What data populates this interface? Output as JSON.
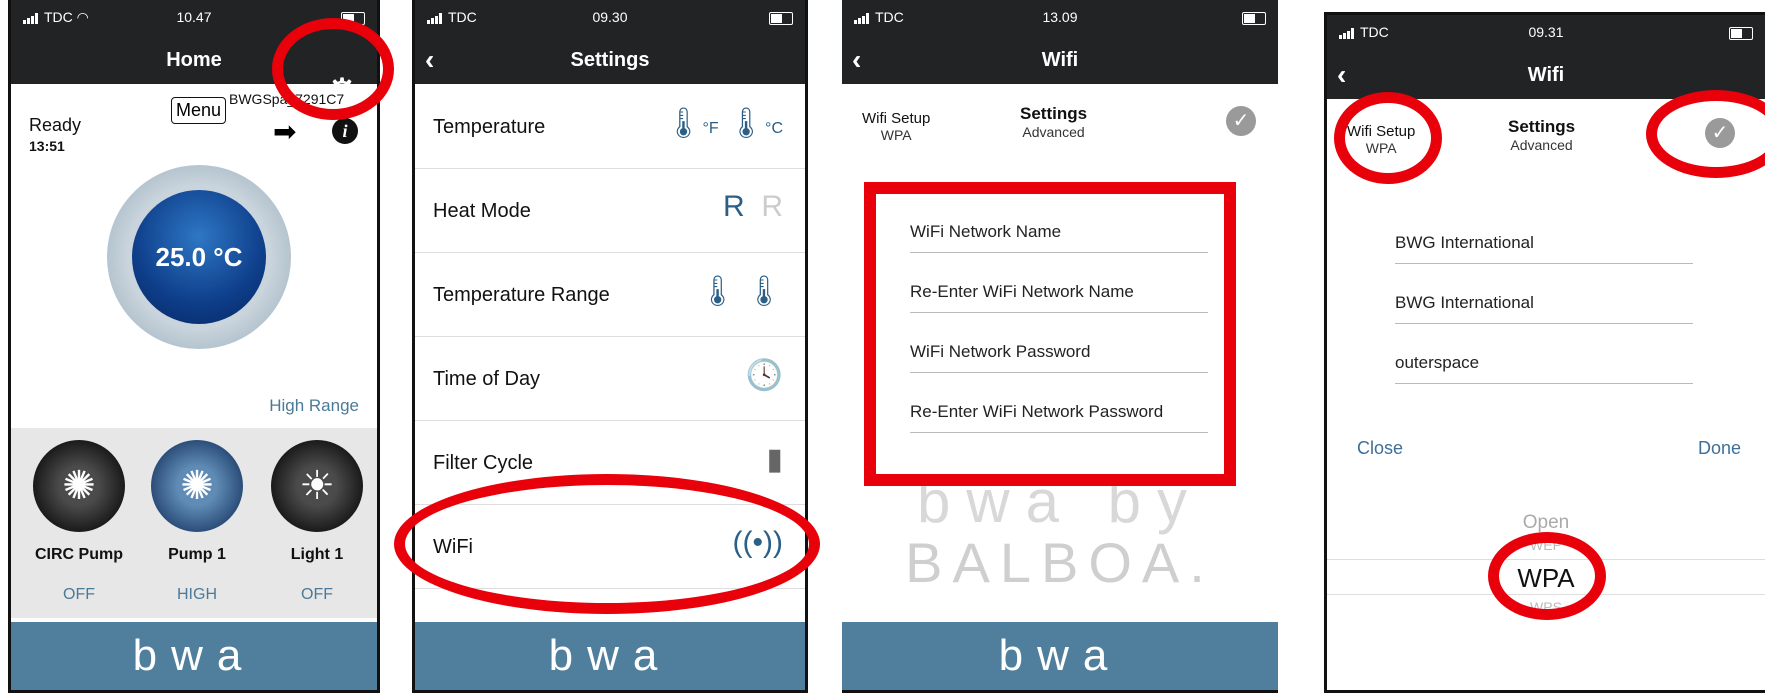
{
  "screens": [
    {
      "status": {
        "carrier": "TDC",
        "time": "10.47"
      },
      "title": "Home",
      "ready_label": "Ready",
      "ready_time": "13:51",
      "menu_label": "Menu",
      "spa_name": "BWGSpa_7291C7",
      "temperature": "25.0 °C",
      "range_label": "High Range",
      "devices": [
        {
          "label": "CIRC Pump",
          "state": "OFF",
          "icon": "circ-pump-icon"
        },
        {
          "label": "Pump 1",
          "state": "HIGH",
          "icon": "pump-icon"
        },
        {
          "label": "Light 1",
          "state": "OFF",
          "icon": "light-icon"
        }
      ],
      "brand": "bwa"
    },
    {
      "status": {
        "carrier": "TDC",
        "time": "09.30"
      },
      "title": "Settings",
      "rows": [
        {
          "label": "Temperature",
          "icon": "thermometer-icon",
          "units": [
            "°F",
            "°C"
          ]
        },
        {
          "label": "Heat Mode",
          "icon": "heat-mode-icon",
          "values": [
            "R",
            "R"
          ]
        },
        {
          "label": "Temperature Range",
          "icon": "range-icon"
        },
        {
          "label": "Time of Day",
          "icon": "clock-icon"
        },
        {
          "label": "Filter Cycle",
          "icon": "filter-icon"
        },
        {
          "label": "WiFi",
          "icon": "wifi-icon"
        }
      ],
      "brand": "bwa"
    },
    {
      "status": {
        "carrier": "TDC",
        "time": "13.09"
      },
      "title": "Wifi",
      "tab_setup": "Wifi Setup",
      "tab_setup_sub": "WPA",
      "tab_settings": "Settings",
      "tab_settings_sub": "Advanced",
      "fields": [
        "WiFi Network Name",
        "Re-Enter WiFi Network Name",
        "WiFi Network Password",
        "Re-Enter WiFi Network Password"
      ],
      "watermark1": "bwa by",
      "watermark2": "BALBOA.",
      "brand": "bwa"
    },
    {
      "status": {
        "carrier": "TDC",
        "time": "09.31"
      },
      "title": "Wifi",
      "tab_setup": "Wifi Setup",
      "tab_setup_sub": "WPA",
      "tab_settings": "Settings",
      "tab_settings_sub": "Advanced",
      "values": [
        "BWG International",
        "BWG International",
        "outerspace"
      ],
      "close_label": "Close",
      "done_label": "Done",
      "picker_options": [
        "Open",
        "WEP",
        "WPA",
        "WPS"
      ],
      "picker_selected": "WPA"
    }
  ],
  "colors": {
    "highlight": "#e8000a",
    "footer": "#4f7f9c",
    "accent": "#3d6f99"
  }
}
